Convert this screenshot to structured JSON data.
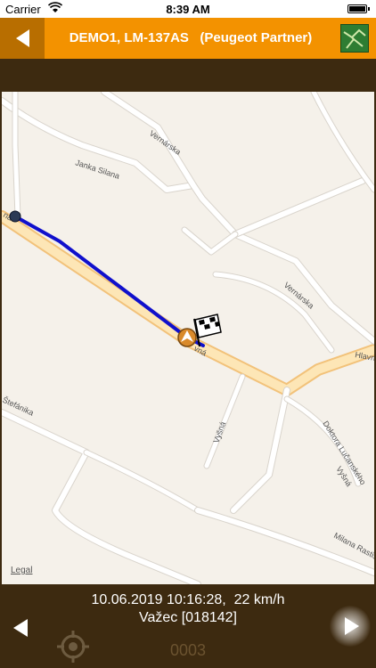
{
  "status_bar": {
    "carrier": "Carrier",
    "time": "8:39 AM",
    "battery_level": 1.0
  },
  "header": {
    "title": "DEMO1, LM-137AS   (Peugeot Partner)",
    "back_icon": "back-arrow-icon",
    "map_icon": "map-icon",
    "accent": "#f39200"
  },
  "map": {
    "street_labels": [
      "Vernárska",
      "Janka Silana",
      "Vernárska",
      "Hlavná",
      "Vyšná",
      "Doktora Lučanského",
      "Vyšná",
      "Milana Rastislava",
      "Štefánika",
      "na",
      "vná"
    ],
    "legal": "Legal",
    "route_color": "#1010cc"
  },
  "footer": {
    "datetime_speed": "10.06.2019 10:16:28,  22 km/h",
    "location": "Važec [018142]",
    "counter": "0003"
  }
}
